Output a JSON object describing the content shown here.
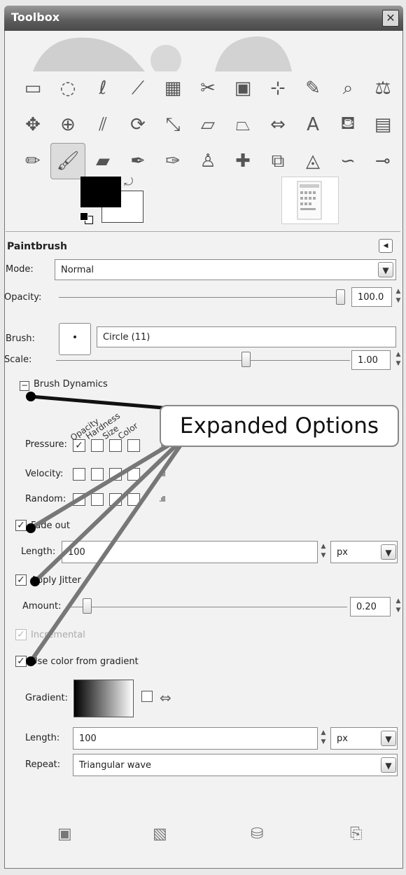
{
  "window": {
    "title": "Toolbox",
    "close_icon": "close-icon"
  },
  "tools": [
    {
      "icon": "▭",
      "name": "rect-select-icon"
    },
    {
      "icon": "◌",
      "name": "ellipse-select-icon"
    },
    {
      "icon": "ℓ",
      "name": "free-select-icon"
    },
    {
      "icon": "⟋",
      "name": "fuzzy-select-icon"
    },
    {
      "icon": "▦",
      "name": "color-select-icon"
    },
    {
      "icon": "✂",
      "name": "scissors-icon"
    },
    {
      "icon": "▣",
      "name": "foreground-select-icon"
    },
    {
      "icon": "⊹",
      "name": "paths-icon"
    },
    {
      "icon": "✎",
      "name": "color-picker-icon"
    },
    {
      "icon": "⌕",
      "name": "zoom-icon"
    },
    {
      "icon": "⚖",
      "name": "measure-icon"
    },
    {
      "icon": "✥",
      "name": "move-icon"
    },
    {
      "icon": "⊕",
      "name": "align-icon"
    },
    {
      "icon": "⫽",
      "name": "crop-icon"
    },
    {
      "icon": "⟳",
      "name": "rotate-icon"
    },
    {
      "icon": "⤡",
      "name": "scale-icon"
    },
    {
      "icon": "▱",
      "name": "shear-icon"
    },
    {
      "icon": "⏢",
      "name": "perspective-icon"
    },
    {
      "icon": "⇔",
      "name": "flip-icon"
    },
    {
      "icon": "A",
      "name": "text-icon"
    },
    {
      "icon": "⛾",
      "name": "bucket-fill-icon"
    },
    {
      "icon": "▤",
      "name": "blend-icon"
    },
    {
      "icon": "✏",
      "name": "pencil-icon"
    },
    {
      "icon": "🖌",
      "name": "paintbrush-icon"
    },
    {
      "icon": "▰",
      "name": "eraser-icon"
    },
    {
      "icon": "✒",
      "name": "airbrush-icon"
    },
    {
      "icon": "✑",
      "name": "ink-icon"
    },
    {
      "icon": "♙",
      "name": "clone-icon"
    },
    {
      "icon": "✚",
      "name": "heal-icon"
    },
    {
      "icon": "⧉",
      "name": "perspective-clone-icon"
    },
    {
      "icon": "◬",
      "name": "blur-icon"
    },
    {
      "icon": "∽",
      "name": "smudge-icon"
    },
    {
      "icon": "⊸",
      "name": "dodge-burn-icon"
    }
  ],
  "active_tool_index": 23,
  "panel": {
    "title": "Paintbrush",
    "mode_label": "Mode:",
    "mode_value": "Normal",
    "opacity_label": "Opacity:",
    "opacity_value": "100.0",
    "brush_label": "Brush:",
    "brush_value": "Circle (11)",
    "scale_label": "Scale:",
    "scale_value": "1.00",
    "dynamics_label": "Brush Dynamics",
    "dyn_columns": [
      "Opacity",
      "Hardness",
      "Size",
      "Color"
    ],
    "dyn_rows": [
      {
        "label": "Pressure:",
        "checked": [
          true,
          false,
          false,
          false
        ]
      },
      {
        "label": "Velocity:",
        "checked": [
          false,
          false,
          false,
          false
        ]
      },
      {
        "label": "Random:",
        "checked": [
          false,
          false,
          false,
          false
        ]
      }
    ],
    "fade_label": "Fade out",
    "fade_length_label": "Length:",
    "fade_length_value": "100",
    "fade_unit": "px",
    "jitter_label": "Apply Jitter",
    "amount_label": "Amount:",
    "amount_value": "0.20",
    "incremental_label": "Incremental",
    "use_gradient_label": "Use color from gradient",
    "gradient_label": "Gradient:",
    "grad_length_label": "Length:",
    "grad_length_value": "100",
    "grad_unit": "px",
    "repeat_label": "Repeat:",
    "repeat_value": "Triangular wave"
  },
  "annotation": {
    "callout_text": "Expanded Options"
  },
  "bottom_buttons": [
    {
      "icon": "▣",
      "name": "save-options-icon"
    },
    {
      "icon": "▧",
      "name": "restore-options-icon"
    },
    {
      "icon": "⛁",
      "name": "delete-options-icon"
    },
    {
      "icon": "⎘",
      "name": "reset-options-icon"
    }
  ]
}
